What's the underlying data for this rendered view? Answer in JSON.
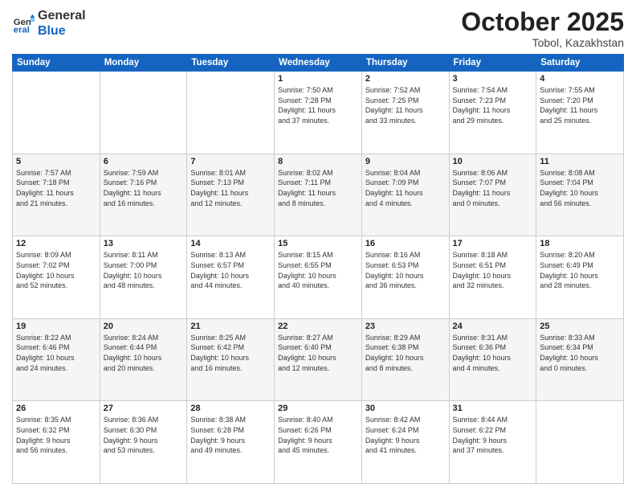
{
  "header": {
    "logo_general": "General",
    "logo_blue": "Blue",
    "month": "October 2025",
    "location": "Tobol, Kazakhstan"
  },
  "weekdays": [
    "Sunday",
    "Monday",
    "Tuesday",
    "Wednesday",
    "Thursday",
    "Friday",
    "Saturday"
  ],
  "weeks": [
    [
      {
        "day": "",
        "info": ""
      },
      {
        "day": "",
        "info": ""
      },
      {
        "day": "",
        "info": ""
      },
      {
        "day": "1",
        "info": "Sunrise: 7:50 AM\nSunset: 7:28 PM\nDaylight: 11 hours\nand 37 minutes."
      },
      {
        "day": "2",
        "info": "Sunrise: 7:52 AM\nSunset: 7:25 PM\nDaylight: 11 hours\nand 33 minutes."
      },
      {
        "day": "3",
        "info": "Sunrise: 7:54 AM\nSunset: 7:23 PM\nDaylight: 11 hours\nand 29 minutes."
      },
      {
        "day": "4",
        "info": "Sunrise: 7:55 AM\nSunset: 7:20 PM\nDaylight: 11 hours\nand 25 minutes."
      }
    ],
    [
      {
        "day": "5",
        "info": "Sunrise: 7:57 AM\nSunset: 7:18 PM\nDaylight: 11 hours\nand 21 minutes."
      },
      {
        "day": "6",
        "info": "Sunrise: 7:59 AM\nSunset: 7:16 PM\nDaylight: 11 hours\nand 16 minutes."
      },
      {
        "day": "7",
        "info": "Sunrise: 8:01 AM\nSunset: 7:13 PM\nDaylight: 11 hours\nand 12 minutes."
      },
      {
        "day": "8",
        "info": "Sunrise: 8:02 AM\nSunset: 7:11 PM\nDaylight: 11 hours\nand 8 minutes."
      },
      {
        "day": "9",
        "info": "Sunrise: 8:04 AM\nSunset: 7:09 PM\nDaylight: 11 hours\nand 4 minutes."
      },
      {
        "day": "10",
        "info": "Sunrise: 8:06 AM\nSunset: 7:07 PM\nDaylight: 11 hours\nand 0 minutes."
      },
      {
        "day": "11",
        "info": "Sunrise: 8:08 AM\nSunset: 7:04 PM\nDaylight: 10 hours\nand 56 minutes."
      }
    ],
    [
      {
        "day": "12",
        "info": "Sunrise: 8:09 AM\nSunset: 7:02 PM\nDaylight: 10 hours\nand 52 minutes."
      },
      {
        "day": "13",
        "info": "Sunrise: 8:11 AM\nSunset: 7:00 PM\nDaylight: 10 hours\nand 48 minutes."
      },
      {
        "day": "14",
        "info": "Sunrise: 8:13 AM\nSunset: 6:57 PM\nDaylight: 10 hours\nand 44 minutes."
      },
      {
        "day": "15",
        "info": "Sunrise: 8:15 AM\nSunset: 6:55 PM\nDaylight: 10 hours\nand 40 minutes."
      },
      {
        "day": "16",
        "info": "Sunrise: 8:16 AM\nSunset: 6:53 PM\nDaylight: 10 hours\nand 36 minutes."
      },
      {
        "day": "17",
        "info": "Sunrise: 8:18 AM\nSunset: 6:51 PM\nDaylight: 10 hours\nand 32 minutes."
      },
      {
        "day": "18",
        "info": "Sunrise: 8:20 AM\nSunset: 6:49 PM\nDaylight: 10 hours\nand 28 minutes."
      }
    ],
    [
      {
        "day": "19",
        "info": "Sunrise: 8:22 AM\nSunset: 6:46 PM\nDaylight: 10 hours\nand 24 minutes."
      },
      {
        "day": "20",
        "info": "Sunrise: 8:24 AM\nSunset: 6:44 PM\nDaylight: 10 hours\nand 20 minutes."
      },
      {
        "day": "21",
        "info": "Sunrise: 8:25 AM\nSunset: 6:42 PM\nDaylight: 10 hours\nand 16 minutes."
      },
      {
        "day": "22",
        "info": "Sunrise: 8:27 AM\nSunset: 6:40 PM\nDaylight: 10 hours\nand 12 minutes."
      },
      {
        "day": "23",
        "info": "Sunrise: 8:29 AM\nSunset: 6:38 PM\nDaylight: 10 hours\nand 8 minutes."
      },
      {
        "day": "24",
        "info": "Sunrise: 8:31 AM\nSunset: 6:36 PM\nDaylight: 10 hours\nand 4 minutes."
      },
      {
        "day": "25",
        "info": "Sunrise: 8:33 AM\nSunset: 6:34 PM\nDaylight: 10 hours\nand 0 minutes."
      }
    ],
    [
      {
        "day": "26",
        "info": "Sunrise: 8:35 AM\nSunset: 6:32 PM\nDaylight: 9 hours\nand 56 minutes."
      },
      {
        "day": "27",
        "info": "Sunrise: 8:36 AM\nSunset: 6:30 PM\nDaylight: 9 hours\nand 53 minutes."
      },
      {
        "day": "28",
        "info": "Sunrise: 8:38 AM\nSunset: 6:28 PM\nDaylight: 9 hours\nand 49 minutes."
      },
      {
        "day": "29",
        "info": "Sunrise: 8:40 AM\nSunset: 6:26 PM\nDaylight: 9 hours\nand 45 minutes."
      },
      {
        "day": "30",
        "info": "Sunrise: 8:42 AM\nSunset: 6:24 PM\nDaylight: 9 hours\nand 41 minutes."
      },
      {
        "day": "31",
        "info": "Sunrise: 8:44 AM\nSunset: 6:22 PM\nDaylight: 9 hours\nand 37 minutes."
      },
      {
        "day": "",
        "info": ""
      }
    ]
  ]
}
